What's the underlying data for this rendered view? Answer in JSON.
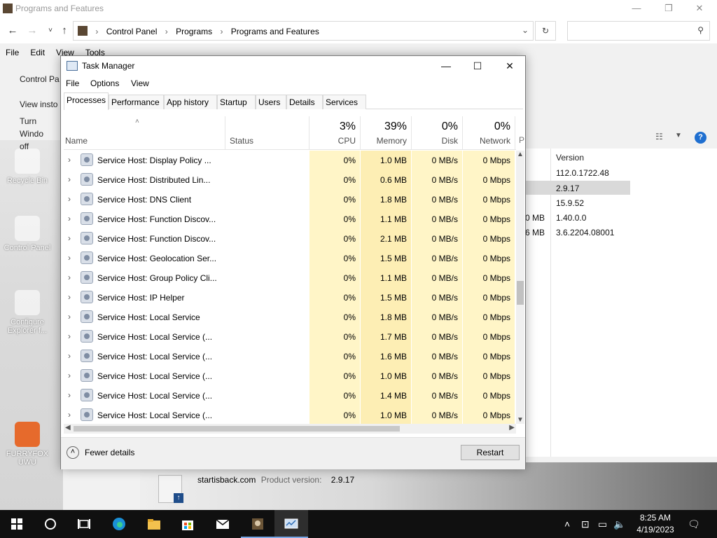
{
  "explorer": {
    "title": "Programs and Features",
    "window_controls": [
      "—",
      "❐",
      "✕"
    ],
    "breadcrumb": [
      "Control Panel",
      "Programs",
      "Programs and Features"
    ],
    "menu": [
      "File",
      "Edit",
      "View",
      "Tools"
    ],
    "sidebar": [
      "Control Pa",
      "View insto",
      "Turn Windo",
      "off"
    ],
    "version_header": "Version",
    "versions": [
      "112.0.1722.48",
      "2.9.17",
      "15.9.52",
      "1.40.0.0",
      "3.6.2204.08001"
    ],
    "sizes": [
      "0 MB",
      "6 MB"
    ],
    "details": {
      "name": "startisback.com",
      "product_version_label": "Product version:",
      "product_version": "2.9.17"
    }
  },
  "desktop_icons": [
    "Recycle Bin",
    "Control Panel",
    "Configure Explorer f...",
    "FURRYFOX UWU"
  ],
  "task_manager": {
    "title": "Task Manager",
    "window_controls": [
      "—",
      "☐",
      "✕"
    ],
    "menu": [
      "File",
      "Options",
      "View"
    ],
    "tabs": [
      "Processes",
      "Performance",
      "App history",
      "Startup",
      "Users",
      "Details",
      "Services"
    ],
    "active_tab": "Processes",
    "columns": {
      "name": "Name",
      "status": "Status",
      "cpu": {
        "label": "CPU",
        "total": "3%"
      },
      "memory": {
        "label": "Memory",
        "total": "39%"
      },
      "disk": {
        "label": "Disk",
        "total": "0%"
      },
      "network": {
        "label": "Network",
        "total": "0%"
      },
      "power_partial": "P"
    },
    "rows": [
      {
        "name": "Service Host: Display Policy ...",
        "cpu": "0%",
        "memory": "1.0 MB",
        "disk": "0 MB/s",
        "network": "0 Mbps"
      },
      {
        "name": "Service Host: Distributed Lin...",
        "cpu": "0%",
        "memory": "0.6 MB",
        "disk": "0 MB/s",
        "network": "0 Mbps"
      },
      {
        "name": "Service Host: DNS Client",
        "cpu": "0%",
        "memory": "1.8 MB",
        "disk": "0 MB/s",
        "network": "0 Mbps"
      },
      {
        "name": "Service Host: Function Discov...",
        "cpu": "0%",
        "memory": "1.1 MB",
        "disk": "0 MB/s",
        "network": "0 Mbps"
      },
      {
        "name": "Service Host: Function Discov...",
        "cpu": "0%",
        "memory": "2.1 MB",
        "disk": "0 MB/s",
        "network": "0 Mbps"
      },
      {
        "name": "Service Host: Geolocation Ser...",
        "cpu": "0%",
        "memory": "1.5 MB",
        "disk": "0 MB/s",
        "network": "0 Mbps"
      },
      {
        "name": "Service Host: Group Policy Cli...",
        "cpu": "0%",
        "memory": "1.1 MB",
        "disk": "0 MB/s",
        "network": "0 Mbps"
      },
      {
        "name": "Service Host: IP Helper",
        "cpu": "0%",
        "memory": "1.5 MB",
        "disk": "0 MB/s",
        "network": "0 Mbps"
      },
      {
        "name": "Service Host: Local Service",
        "cpu": "0%",
        "memory": "1.8 MB",
        "disk": "0 MB/s",
        "network": "0 Mbps"
      },
      {
        "name": "Service Host: Local Service (...",
        "cpu": "0%",
        "memory": "1.7 MB",
        "disk": "0 MB/s",
        "network": "0 Mbps"
      },
      {
        "name": "Service Host: Local Service (...",
        "cpu": "0%",
        "memory": "1.6 MB",
        "disk": "0 MB/s",
        "network": "0 Mbps"
      },
      {
        "name": "Service Host: Local Service (...",
        "cpu": "0%",
        "memory": "1.0 MB",
        "disk": "0 MB/s",
        "network": "0 Mbps"
      },
      {
        "name": "Service Host: Local Service (...",
        "cpu": "0%",
        "memory": "1.4 MB",
        "disk": "0 MB/s",
        "network": "0 Mbps"
      },
      {
        "name": "Service Host: Local Service (...",
        "cpu": "0%",
        "memory": "1.0 MB",
        "disk": "0 MB/s",
        "network": "0 Mbps"
      }
    ],
    "footer": {
      "fewer_details": "Fewer details",
      "restart": "Restart"
    },
    "colors": {
      "cpu_col": "#fff5c7",
      "memory_col": "#fdeeb4",
      "disk_col": "#fff5c7",
      "network_col": "#fff5c7"
    }
  },
  "taskbar": {
    "icons": [
      "windows-start-icon",
      "cortana-icon",
      "task-view-icon",
      "edge-icon",
      "file-explorer-icon",
      "store-icon",
      "mail-icon",
      "app-icon",
      "task-manager-icon"
    ],
    "clock": {
      "time": "8:25 AM",
      "date": "4/19/2023"
    }
  }
}
